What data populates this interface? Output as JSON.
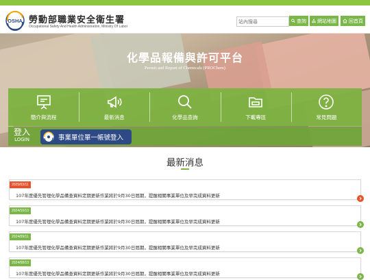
{
  "header": {
    "org_name": "勞動部職業安全衛生署",
    "org_sub": "Occupational Safety And Health Administration, Ministry Of Labor",
    "logo_text": "OSHA",
    "search_placeholder": "站內搜尋",
    "search_label": "查詢",
    "sitemap_label": "網站地圖",
    "home_label": "回首頁"
  },
  "hero": {
    "title": "化學品報備與許可平台",
    "subtitle": "Permit and Report of Chemicals (PROChem)"
  },
  "nav": [
    {
      "label": "簡介與流程",
      "icon": "presentation-board-icon"
    },
    {
      "label": "最新消息",
      "icon": "megaphone-icon"
    },
    {
      "label": "化學品查詢",
      "icon": "search-icon"
    },
    {
      "label": "下載專區",
      "icon": "folder-icon"
    },
    {
      "label": "常見問題",
      "icon": "question-icon"
    }
  ],
  "login": {
    "label_zh": "登入",
    "label_en": "LOGIN",
    "sso_label": "事業單位單一帳號登入"
  },
  "news_section": {
    "title": "最新消息",
    "items": [
      {
        "date": "2025/03/11",
        "text": "107年度優先管理化學品備查資料定期更新作業將於9月30日屆期，提醒相關事業單位及早完成資料更新",
        "color": "#e8512a"
      },
      {
        "date": "2024/10/13",
        "text": "107年度優先管理化學品備查資料定期更新作業將於9月30日屆期，提醒相關事業單位及早完成資料更新",
        "color": "#7ab648"
      },
      {
        "date": "2024/09/11",
        "text": "107年度優先管理化學品備查資料定期更新作業將於9月30日屆期，提醒相關事業單位及早完成資料更新",
        "color": "#7ab648"
      },
      {
        "date": "2024/08/13",
        "text": "107年度優先管理化學品備查資料定期更新作業將於9月30日屆期，提醒相關事業單位及早完成資料更新",
        "color": "#7ab648"
      }
    ]
  },
  "colors": {
    "accent_green": "#7ab648",
    "accent_orange": "#e8512a",
    "login_blue": "#2d4a86"
  }
}
